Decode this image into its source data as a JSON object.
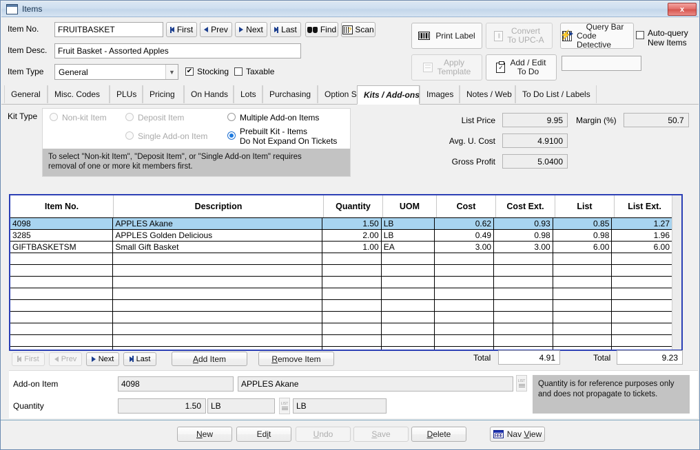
{
  "window": {
    "title": "Items",
    "close_label": "x"
  },
  "header": {
    "item_no_label": "Item No.",
    "item_no_value": "FRUITBASKET",
    "item_desc_label": "Item Desc.",
    "item_desc_value": "Fruit Basket - Assorted Apples",
    "item_type_label": "Item Type",
    "item_type_value": "General",
    "stocking_label": "Stocking",
    "stocking_checked": true,
    "taxable_label": "Taxable",
    "taxable_checked": false,
    "nav": [
      {
        "label": "First",
        "icon": "first-icon",
        "disabled": false
      },
      {
        "label": "Prev",
        "icon": "prev-icon",
        "disabled": false
      },
      {
        "label": "Next",
        "icon": "next-icon",
        "disabled": false
      },
      {
        "label": "Last",
        "icon": "last-icon",
        "disabled": false
      }
    ],
    "find_label": "Find",
    "scan_label": "Scan"
  },
  "toolbar": {
    "print_label": "Print Label",
    "convert_line1": "Convert",
    "convert_line2": "To UPC-A",
    "query_line1": "Query Bar",
    "query_line2": "Code Detective",
    "autoquery_line1": "Auto-query",
    "autoquery_line2": "New Items",
    "autoquery_checked": false,
    "apply_line1": "Apply",
    "apply_line2": "Template",
    "addedit_line1": "Add / Edit",
    "addedit_line2": "To Do",
    "blank_field_value": ""
  },
  "tabs": [
    {
      "label": "General",
      "active": false
    },
    {
      "label": "Misc. Codes",
      "active": false
    },
    {
      "label": "PLUs",
      "active": false
    },
    {
      "label": "Pricing",
      "active": false
    },
    {
      "label": "On Hands",
      "active": false
    },
    {
      "label": "Lots",
      "active": false
    },
    {
      "label": "Purchasing",
      "active": false
    },
    {
      "label": "Option Sets",
      "active": false
    },
    {
      "label": "Kits / Add-ons",
      "active": true
    },
    {
      "label": "Images",
      "active": false
    },
    {
      "label": "Notes / Web",
      "active": false
    },
    {
      "label": "To Do List / Labels",
      "active": false
    }
  ],
  "kit": {
    "kit_type_label": "Kit Type",
    "options": [
      {
        "label": "Non-kit Item",
        "selected": false,
        "disabled": true
      },
      {
        "label": "Deposit Item",
        "selected": false,
        "disabled": true
      },
      {
        "label": "Multiple Add-on Items",
        "selected": false,
        "disabled": false
      },
      {
        "label": "Single Add-on Item",
        "selected": false,
        "disabled": true
      },
      {
        "label": "Prebuilt Kit - Items\nDo Not Expand On Tickets",
        "selected": true,
        "disabled": false
      }
    ],
    "prebuilt_line1": "Prebuilt Kit - Items",
    "prebuilt_line2": "Do Not Expand On Tickets",
    "note_line1": "To select  \"Non-kit Item\", \"Deposit Item\", or \"Single Add-on Item\" requires",
    "note_line2": "removal of one or more kit members first."
  },
  "prices": {
    "list_price_label": "List Price",
    "list_price_value": "9.95",
    "margin_label": "Margin (%)",
    "margin_value": "50.7",
    "avg_cost_label": "Avg. U. Cost",
    "avg_cost_value": "4.9100",
    "gross_profit_label": "Gross Profit",
    "gross_profit_value": "5.0400"
  },
  "grid": {
    "columns": [
      "Item No.",
      "Description",
      "Quantity",
      "UOM",
      "Cost",
      "Cost Ext.",
      "List",
      "List Ext."
    ],
    "rows": [
      {
        "item_no": "4098",
        "description": "APPLES  Akane",
        "quantity": "1.50",
        "uom": "LB",
        "cost": "0.62",
        "cost_ext": "0.93",
        "list": "0.85",
        "list_ext": "1.27",
        "selected": true
      },
      {
        "item_no": "3285",
        "description": "APPLES Golden Delicious",
        "quantity": "2.00",
        "uom": "LB",
        "cost": "0.49",
        "cost_ext": "0.98",
        "list": "0.98",
        "list_ext": "1.96",
        "selected": false
      },
      {
        "item_no": "GIFTBASKETSM",
        "description": "Small Gift Basket",
        "quantity": "1.00",
        "uom": "EA",
        "cost": "3.00",
        "cost_ext": "3.00",
        "list": "6.00",
        "list_ext": "6.00",
        "selected": false
      }
    ],
    "empty_row_count": 8
  },
  "gridnav": {
    "first_label": "First",
    "prev_label": "Prev",
    "next_label": "Next",
    "last_label": "Last",
    "add_item_label": "Add Item",
    "remove_item_label": "Remove Item",
    "total_cost_label": "Total",
    "total_cost_value": "4.91",
    "total_list_label": "Total",
    "total_list_value": "9.23"
  },
  "addon": {
    "item_label": "Add-on Item",
    "item_no_value": "4098",
    "item_desc_value": "APPLES  Akane",
    "quantity_label": "Quantity",
    "quantity_value": "1.50",
    "uom_value": "LB",
    "uom2_value": "LB",
    "hint_line1": "Quantity is for reference purposes only",
    "hint_line2": "and does not propagate to tickets."
  },
  "footer": {
    "buttons": [
      {
        "label": "New",
        "accel": "N",
        "disabled": false
      },
      {
        "label": "Edit",
        "accel": "i",
        "disabled": false
      },
      {
        "label": "Undo",
        "accel": "U",
        "disabled": true
      },
      {
        "label": "Save",
        "accel": "S",
        "disabled": true
      },
      {
        "label": "Delete",
        "accel": "D",
        "disabled": false
      }
    ],
    "nav_view_label": "Nav View"
  },
  "colors": {
    "selection": "#a8d4f0",
    "grid_border": "#2b3fb5",
    "title_accent": "#c3d6ea",
    "note_bg": "#c3c3c3",
    "radio_on": "#1c7ae0"
  }
}
